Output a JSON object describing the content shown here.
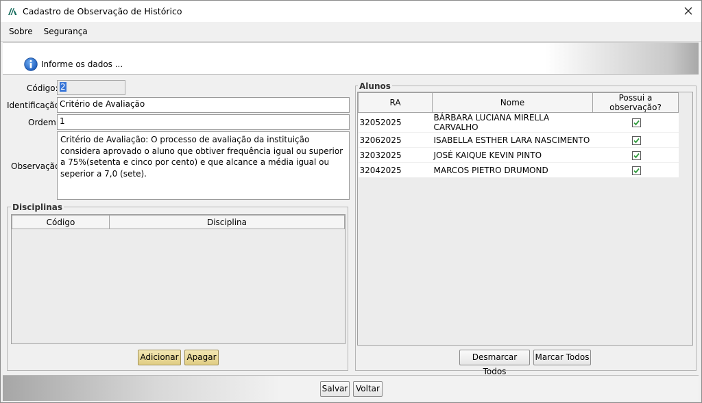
{
  "window": {
    "title": "Cadastro de Observação de Histórico"
  },
  "menu": {
    "items": [
      "Sobre",
      "Segurança"
    ]
  },
  "banner": {
    "text": "Informe os dados ..."
  },
  "form": {
    "codigo_label": "Código:",
    "codigo_value": "2",
    "identificacao_label": "Identificação:",
    "identificacao_value": "Critério de Avaliação",
    "ordem_label": "Ordem:",
    "ordem_value": "1",
    "observacao_label": "Observação:",
    "observacao_value": "Critério de Avaliação: O processo de avaliação da instituição considera aprovado o aluno que obtiver frequência igual ou superior a 75%(setenta e cinco por cento) e que alcance a média igual ou seperior a 7,0 (sete)."
  },
  "disciplinas": {
    "title": "Disciplinas",
    "columns": [
      "Código",
      "Disciplina"
    ],
    "add_label": "Adicionar",
    "delete_label": "Apagar"
  },
  "alunos": {
    "title": "Alunos",
    "columns": [
      "RA",
      "Nome",
      "Possui a observação?"
    ],
    "rows": [
      {
        "ra": "32052025",
        "nome": "BÁRBARA LUCIANA MIRELLA CARVALHO",
        "checked": true
      },
      {
        "ra": "32062025",
        "nome": "ISABELLA ESTHER LARA NASCIMENTO",
        "checked": true
      },
      {
        "ra": "32032025",
        "nome": "JOSÉ KAIQUE KEVIN PINTO",
        "checked": true
      },
      {
        "ra": "32042025",
        "nome": "MARCOS PIETRO DRUMOND",
        "checked": true
      }
    ],
    "uncheck_all_label": "Desmarcar Todos",
    "check_all_label": "Marcar Todos"
  },
  "footer": {
    "save_label": "Salvar",
    "back_label": "Voltar"
  },
  "colors": {
    "accent": "#3875d7",
    "check": "#2e9a3a",
    "info": "#1f5fbf"
  }
}
